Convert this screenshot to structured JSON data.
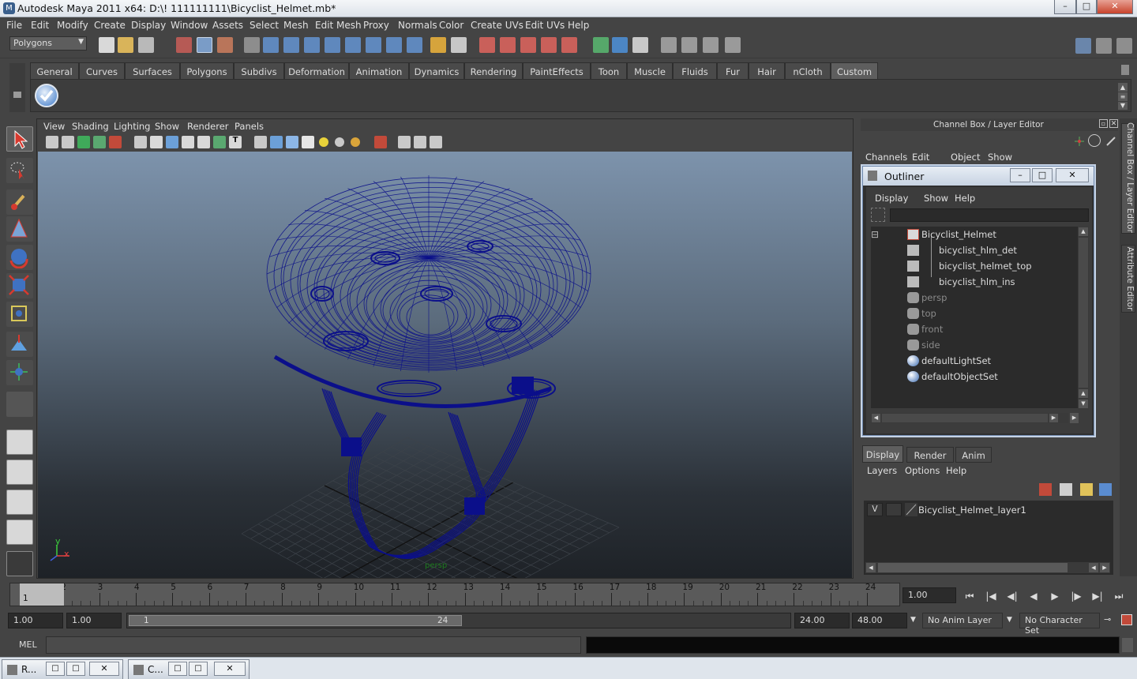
{
  "window": {
    "title": "Autodesk Maya 2011 x64: D:\\! 111111111\\Bicyclist_Helmet.mb*",
    "app_icon": "M",
    "min": "–",
    "max": "□",
    "close": "✕"
  },
  "menubar": [
    "File",
    "Edit",
    "Modify",
    "Create",
    "Display",
    "Window",
    "Assets",
    "Select",
    "Mesh",
    "Edit Mesh",
    "Proxy",
    "Normals",
    "Color",
    "Create UVs",
    "Edit UVs",
    "Help"
  ],
  "mode_selector": "Polygons",
  "shelf": {
    "tabs": [
      "General",
      "Curves",
      "Surfaces",
      "Polygons",
      "Subdivs",
      "Deformation",
      "Animation",
      "Dynamics",
      "Rendering",
      "PaintEffects",
      "Toon",
      "Muscle",
      "Fluids",
      "Fur",
      "Hair",
      "nCloth",
      "Custom"
    ],
    "active": "Custom"
  },
  "viewport": {
    "menu": [
      "View",
      "Shading",
      "Lighting",
      "Show",
      "Renderer",
      "Panels"
    ],
    "camera_label": "persp",
    "axis_x": "x",
    "axis_y": "y",
    "wireframe_color": "#0b0f8a"
  },
  "channel_box": {
    "title": "Channel Box / Layer Editor",
    "menu": [
      "Channels",
      "Edit",
      "Object",
      "Show"
    ]
  },
  "outliner": {
    "title": "Outliner",
    "menu": [
      "Display",
      "Show",
      "Help"
    ],
    "collapse_symbol": "⊟",
    "items": [
      {
        "label": "Bicyclist_Helmet",
        "kind": "group",
        "dim": false
      },
      {
        "label": "bicyclist_hlm_det",
        "kind": "mesh",
        "dim": false
      },
      {
        "label": "bicyclist_helmet_top",
        "kind": "mesh",
        "dim": false
      },
      {
        "label": "bicyclist_hlm_ins",
        "kind": "mesh",
        "dim": false
      },
      {
        "label": "persp",
        "kind": "camera",
        "dim": true
      },
      {
        "label": "top",
        "kind": "camera",
        "dim": true
      },
      {
        "label": "front",
        "kind": "camera",
        "dim": true
      },
      {
        "label": "side",
        "kind": "camera",
        "dim": true
      },
      {
        "label": "defaultLightSet",
        "kind": "set",
        "dim": false
      },
      {
        "label": "defaultObjectSet",
        "kind": "set",
        "dim": false
      }
    ]
  },
  "layer_editor": {
    "tabs": [
      "Display",
      "Render",
      "Anim"
    ],
    "active": "Display",
    "menu": [
      "Layers",
      "Options",
      "Help"
    ],
    "layer": {
      "visibility": "V",
      "name": "Bicyclist_Helmet_layer1"
    }
  },
  "side_tabs": [
    "Channel Box / Layer Editor",
    "Attribute Editor"
  ],
  "timeline": {
    "ticks": [
      "1",
      "2",
      "3",
      "4",
      "5",
      "6",
      "7",
      "8",
      "9",
      "10",
      "11",
      "12",
      "13",
      "14",
      "15",
      "16",
      "17",
      "18",
      "19",
      "20",
      "21",
      "22",
      "23",
      "24"
    ],
    "current_frame_marker": "1",
    "current_time": "1.00",
    "playback_icons": [
      "go-to-start-icon",
      "step-back-key-icon",
      "step-back-frame-icon",
      "play-backward-icon",
      "play-forward-icon",
      "step-forward-frame-icon",
      "step-forward-key-icon",
      "go-to-end-icon"
    ]
  },
  "range": {
    "start": "1.00",
    "playback_start": "1.00",
    "slider_start": "1",
    "slider_end": "24",
    "playback_end": "24.00",
    "end": "48.00",
    "anim_layer": "No Anim Layer",
    "character_set": "No Character Set"
  },
  "command_line": {
    "label": "MEL"
  },
  "taskbar": [
    {
      "label": "R..."
    },
    {
      "label": "C..."
    }
  ]
}
